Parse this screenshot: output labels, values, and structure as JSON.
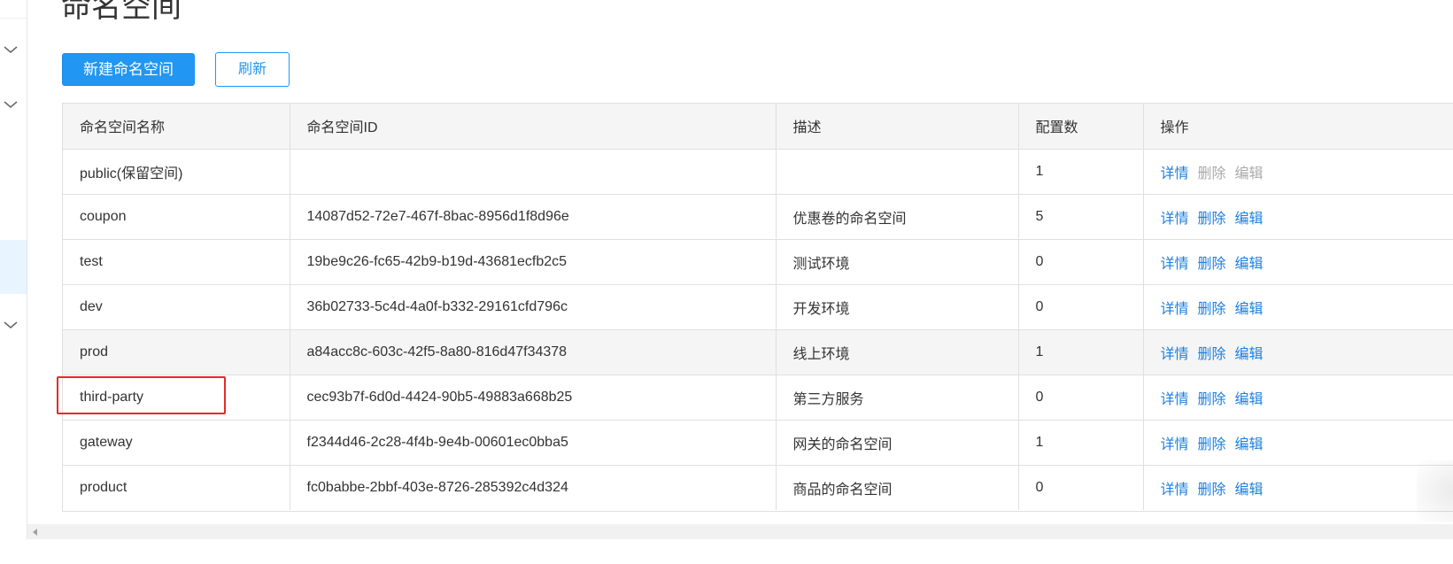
{
  "page": {
    "title": "命名空间"
  },
  "toolbar": {
    "create_label": "新建命名空间",
    "refresh_label": "刷新"
  },
  "table": {
    "headers": {
      "name": "命名空间名称",
      "id": "命名空间ID",
      "desc": "描述",
      "count": "配置数",
      "ops": "操作"
    },
    "rows": [
      {
        "name": "public(保留空间)",
        "id": "",
        "desc": "",
        "count": "1",
        "detail": "详情",
        "delete": "删除",
        "edit": "编辑"
      },
      {
        "name": "coupon",
        "id": "14087d52-72e7-467f-8bac-8956d1f8d96e",
        "desc": "优惠卷的命名空间",
        "count": "5",
        "detail": "详情",
        "delete": "删除",
        "edit": "编辑"
      },
      {
        "name": "test",
        "id": "19be9c26-fc65-42b9-b19d-43681ecfb2c5",
        "desc": "测试环境",
        "count": "0",
        "detail": "详情",
        "delete": "删除",
        "edit": "编辑"
      },
      {
        "name": "dev",
        "id": "36b02733-5c4d-4a0f-b332-29161cfd796c",
        "desc": "开发环境",
        "count": "0",
        "detail": "详情",
        "delete": "删除",
        "edit": "编辑"
      },
      {
        "name": "prod",
        "id": "a84acc8c-603c-42f5-8a80-816d47f34378",
        "desc": "线上环境",
        "count": "1",
        "detail": "详情",
        "delete": "删除",
        "edit": "编辑"
      },
      {
        "name": "third-party",
        "id": "cec93b7f-6d0d-4424-90b5-49883a668b25",
        "desc": "第三方服务",
        "count": "0",
        "detail": "详情",
        "delete": "删除",
        "edit": "编辑"
      },
      {
        "name": "gateway",
        "id": "f2344d46-2c28-4f4b-9e4b-00601ec0bba5",
        "desc": "网关的命名空间",
        "count": "1",
        "detail": "详情",
        "delete": "删除",
        "edit": "编辑"
      },
      {
        "name": "product",
        "id": "fc0babbe-2bbf-403e-8726-285392c4d324",
        "desc": "商品的命名空间",
        "count": "0",
        "detail": "详情",
        "delete": "删除",
        "edit": "编辑"
      }
    ]
  },
  "sidebar": {
    "icons": [
      "chevron-down-icon",
      "chevron-down-icon",
      "chevron-down-icon"
    ]
  },
  "colors": {
    "primary": "#2196f3",
    "link": "#1e7fe0",
    "disabled": "#aaaaaa",
    "highlight_box": "#e5292b",
    "header_bg": "#f5f5f5"
  }
}
